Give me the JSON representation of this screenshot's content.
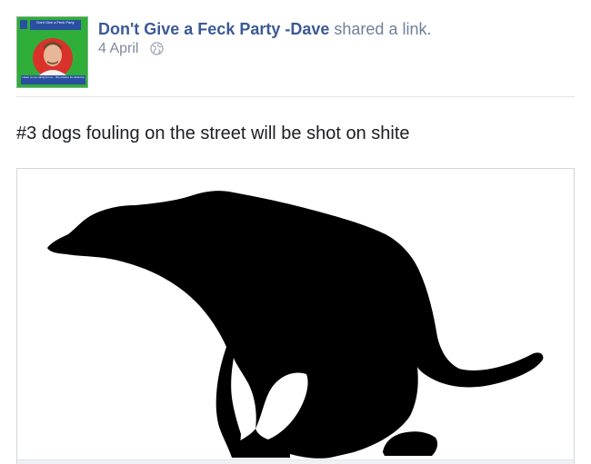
{
  "post": {
    "author": "Don't Give a Feck Party -Dave",
    "action": "shared a link.",
    "date": "4 April",
    "message": "#3 dogs fouling on the street will be shot on shite"
  },
  "avatar": {
    "banner_text": "Dont Give a Feck Party",
    "strip_text": "Listen to me voting for us... We answer for what it is"
  },
  "icons": {
    "audience": "globe-icon",
    "link_image": "dog-silhouette-image"
  },
  "colors": {
    "author_link": "#3b5998",
    "meta_text": "#7f8a9c",
    "avatar_bg": "#2fae3a"
  }
}
